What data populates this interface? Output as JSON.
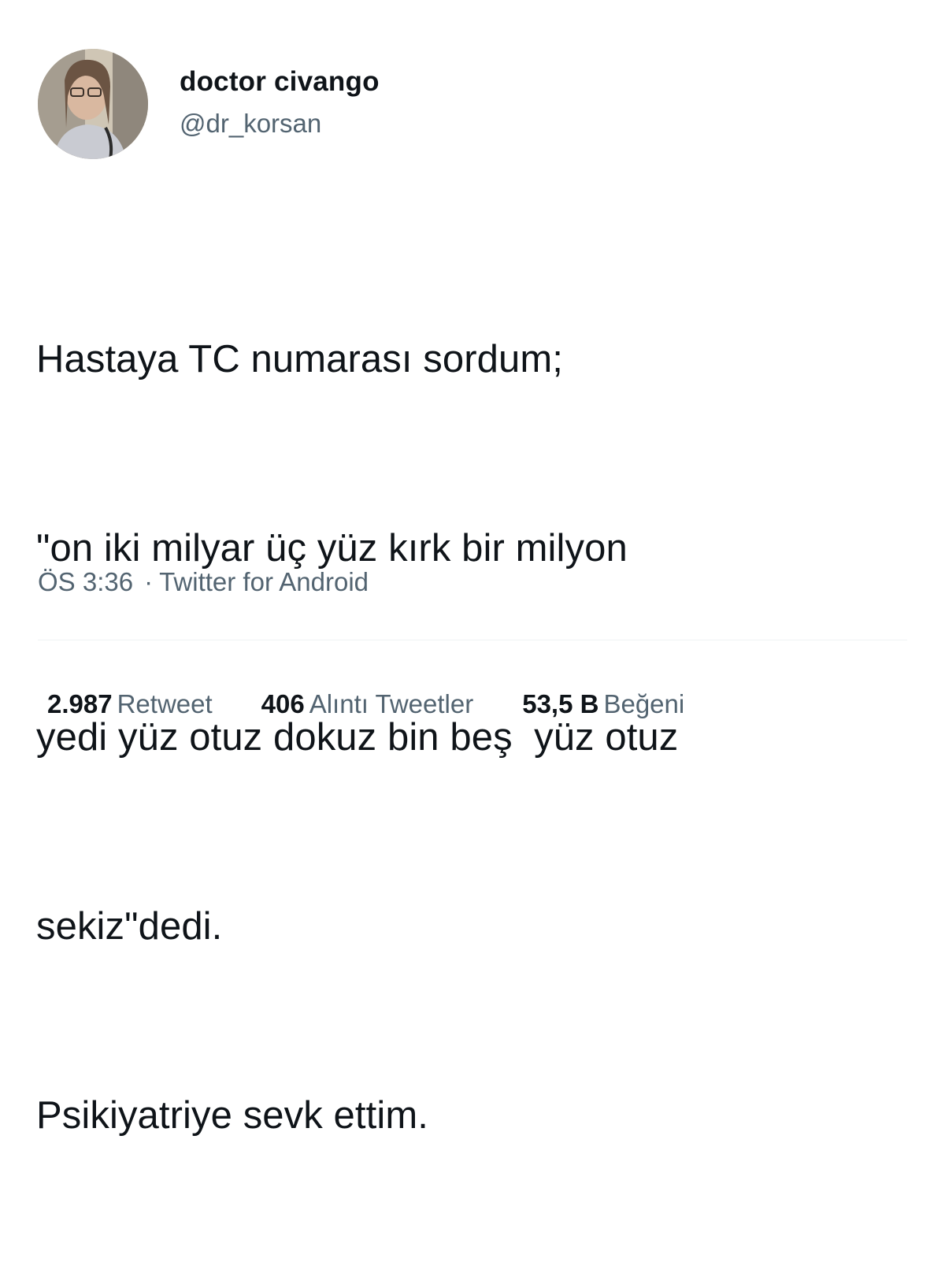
{
  "user": {
    "display_name": "doctor civango",
    "handle": "@dr_korsan"
  },
  "tweet": {
    "lines": [
      "Hastaya TC numarası sordum;",
      "\"on iki milyar üç yüz kırk bir milyon",
      "yedi yüz otuz dokuz bin beş  yüz otuz",
      "sekiz\"dedi.",
      "Psikiyatriye sevk ettim."
    ],
    "time": "ÖS 3:36",
    "separator": "·",
    "source": "Twitter for Android"
  },
  "stats": {
    "retweets": {
      "count": "2.987",
      "label": "Retweet"
    },
    "quotes": {
      "count": "406",
      "label": "Alıntı Tweetler"
    },
    "likes": {
      "count": "53,5 B",
      "label": "Beğeni"
    }
  },
  "colors": {
    "text": "#0f1419",
    "secondary": "#536471",
    "divider": "#eff3f4"
  }
}
